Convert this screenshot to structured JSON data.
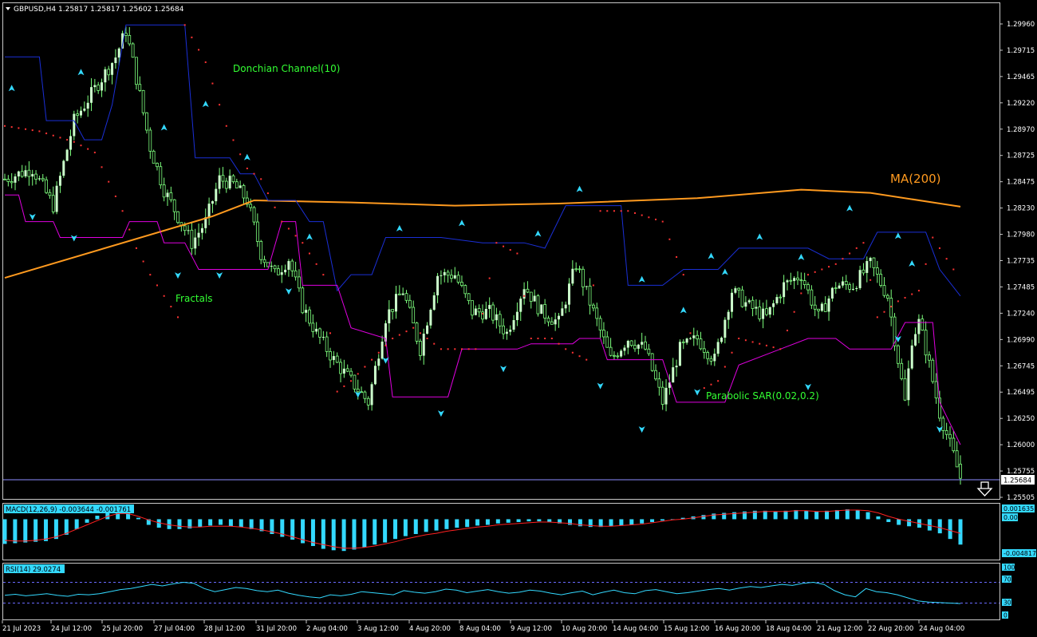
{
  "symbol_header": "GBPUSD,H4  1.25817 1.25817 1.25602 1.25684",
  "colors": {
    "background": "#000000",
    "bull_candle": "#ccffcc",
    "wick": "#7dff7d",
    "donchian": "#1a2fd6",
    "fractal_lower": "#e000e0",
    "ma200": "#ff9a1f",
    "sar": "#ff3333",
    "macd_hist": "#33d9ff",
    "macd_signal": "#ff2020",
    "rsi_line": "#33d9ff",
    "axis_text": "#ffffff",
    "label_green": "#33ff33"
  },
  "annotations": {
    "donchian": "Donchian Channel(10)",
    "fractals": "Fractals",
    "ma": "MA(200)",
    "sar": "Parabolic SAR(0.02,0.2)"
  },
  "price_axis": [
    "1.29960",
    "1.29715",
    "1.29465",
    "1.29220",
    "1.28970",
    "1.28725",
    "1.28475",
    "1.28230",
    "1.27980",
    "1.27735",
    "1.27485",
    "1.27240",
    "1.26990",
    "1.26745",
    "1.26495",
    "1.26250",
    "1.26000",
    "1.25755",
    "1.25505"
  ],
  "current_price": "1.25684",
  "macd": {
    "label": "MACD(12,26,9) -0.003644 -0.001761",
    "axis_top": "0.001635",
    "axis_zero": "0.00",
    "axis_bottom": "-0.004817"
  },
  "rsi": {
    "label": "RSI(14) 29.0274",
    "axis": [
      "100",
      "70",
      "30",
      "0"
    ]
  },
  "time_axis": [
    "21 Jul 2023",
    "24 Jul 12:00",
    "25 Jul 20:00",
    "27 Jul 04:00",
    "28 Jul 12:00",
    "31 Jul 20:00",
    "2 Aug 04:00",
    "3 Aug 12:00",
    "4 Aug 20:00",
    "8 Aug 04:00",
    "9 Aug 12:00",
    "10 Aug 20:00",
    "14 Aug 04:00",
    "15 Aug 12:00",
    "16 Aug 20:00",
    "18 Aug 04:00",
    "21 Aug 12:00",
    "22 Aug 20:00",
    "24 Aug 04:00"
  ],
  "chart_data": {
    "type": "candlestick",
    "symbol": "GBPUSD",
    "timeframe": "H4",
    "ohlc_last": {
      "open": 1.25817,
      "high": 1.25817,
      "low": 1.25602,
      "close": 1.25684
    },
    "ylim": [
      1.2548,
      1.3013
    ],
    "close_path": [
      [
        0,
        1.285
      ],
      [
        8,
        1.286
      ],
      [
        14,
        1.2825
      ],
      [
        20,
        1.2905
      ],
      [
        26,
        1.2935
      ],
      [
        32,
        1.2965
      ],
      [
        35,
        1.299
      ],
      [
        38,
        1.2945
      ],
      [
        42,
        1.288
      ],
      [
        46,
        1.284
      ],
      [
        50,
        1.2815
      ],
      [
        54,
        1.279
      ],
      [
        58,
        1.281
      ],
      [
        62,
        1.285
      ],
      [
        66,
        1.2845
      ],
      [
        70,
        1.283
      ],
      [
        74,
        1.278
      ],
      [
        78,
        1.276
      ],
      [
        82,
        1.2775
      ],
      [
        86,
        1.273
      ],
      [
        90,
        1.2705
      ],
      [
        95,
        1.268
      ],
      [
        100,
        1.266
      ],
      [
        105,
        1.264
      ],
      [
        110,
        1.272
      ],
      [
        115,
        1.2745
      ],
      [
        120,
        1.269
      ],
      [
        125,
        1.276
      ],
      [
        130,
        1.276
      ],
      [
        135,
        1.2725
      ],
      [
        140,
        1.2725
      ],
      [
        145,
        1.2705
      ],
      [
        150,
        1.275
      ],
      [
        155,
        1.2725
      ],
      [
        160,
        1.2715
      ],
      [
        165,
        1.277
      ],
      [
        170,
        1.2725
      ],
      [
        175,
        1.268
      ],
      [
        180,
        1.27
      ],
      [
        185,
        1.269
      ],
      [
        190,
        1.264
      ],
      [
        195,
        1.269
      ],
      [
        200,
        1.27
      ],
      [
        205,
        1.268
      ],
      [
        210,
        1.2745
      ],
      [
        215,
        1.273
      ],
      [
        220,
        1.272
      ],
      [
        225,
        1.275
      ],
      [
        230,
        1.276
      ],
      [
        235,
        1.272
      ],
      [
        240,
        1.275
      ],
      [
        245,
        1.275
      ],
      [
        250,
        1.277
      ],
      [
        255,
        1.274
      ],
      [
        258,
        1.268
      ],
      [
        260,
        1.264
      ],
      [
        262,
        1.27
      ],
      [
        264,
        1.2715
      ],
      [
        266,
        1.269
      ],
      [
        268,
        1.266
      ],
      [
        270,
        1.263
      ],
      [
        272,
        1.261
      ],
      [
        274,
        1.259
      ],
      [
        276,
        1.2568
      ]
    ],
    "ma200": [
      [
        0,
        1.2757
      ],
      [
        60,
        1.2815
      ],
      [
        72,
        1.283
      ],
      [
        100,
        1.2828
      ],
      [
        130,
        1.2825
      ],
      [
        160,
        1.2827
      ],
      [
        200,
        1.2832
      ],
      [
        230,
        1.284
      ],
      [
        250,
        1.2837
      ],
      [
        276,
        1.2824
      ]
    ],
    "donchian_upper": [
      [
        0,
        1.2965
      ],
      [
        10,
        1.2965
      ],
      [
        12,
        1.2905
      ],
      [
        20,
        1.2905
      ],
      [
        23,
        1.2887
      ],
      [
        28,
        1.2887
      ],
      [
        31,
        1.292
      ],
      [
        35,
        1.2995
      ],
      [
        52,
        1.2995
      ],
      [
        55,
        1.287
      ],
      [
        65,
        1.287
      ],
      [
        68,
        1.2855
      ],
      [
        72,
        1.2855
      ],
      [
        76,
        1.283
      ],
      [
        84,
        1.283
      ],
      [
        88,
        1.281
      ],
      [
        92,
        1.281
      ],
      [
        96,
        1.2745
      ],
      [
        100,
        1.276
      ],
      [
        106,
        1.276
      ],
      [
        110,
        1.2795
      ],
      [
        126,
        1.2795
      ],
      [
        138,
        1.279
      ],
      [
        150,
        1.279
      ],
      [
        156,
        1.2785
      ],
      [
        162,
        1.2825
      ],
      [
        178,
        1.2825
      ],
      [
        180,
        1.275
      ],
      [
        190,
        1.275
      ],
      [
        196,
        1.2765
      ],
      [
        206,
        1.2765
      ],
      [
        212,
        1.2785
      ],
      [
        232,
        1.2785
      ],
      [
        238,
        1.2775
      ],
      [
        248,
        1.2775
      ],
      [
        252,
        1.28
      ],
      [
        266,
        1.28
      ],
      [
        270,
        1.2765
      ],
      [
        276,
        1.274
      ]
    ],
    "donchian_lower": [
      [
        0,
        1.2835
      ],
      [
        4,
        1.2835
      ],
      [
        6,
        1.281
      ],
      [
        14,
        1.281
      ],
      [
        16,
        1.2795
      ],
      [
        34,
        1.2795
      ],
      [
        36,
        1.281
      ],
      [
        44,
        1.281
      ],
      [
        46,
        1.279
      ],
      [
        52,
        1.279
      ],
      [
        56,
        1.2765
      ],
      [
        76,
        1.2765
      ],
      [
        80,
        1.281
      ],
      [
        84,
        1.281
      ],
      [
        86,
        1.275
      ],
      [
        96,
        1.275
      ],
      [
        100,
        1.271
      ],
      [
        110,
        1.27
      ],
      [
        112,
        1.2645
      ],
      [
        128,
        1.2645
      ],
      [
        132,
        1.269
      ],
      [
        148,
        1.269
      ],
      [
        152,
        1.2695
      ],
      [
        164,
        1.2695
      ],
      [
        166,
        1.27
      ],
      [
        172,
        1.27
      ],
      [
        174,
        1.268
      ],
      [
        190,
        1.268
      ],
      [
        194,
        1.264
      ],
      [
        208,
        1.264
      ],
      [
        212,
        1.2675
      ],
      [
        224,
        1.269
      ],
      [
        232,
        1.27
      ],
      [
        240,
        1.27
      ],
      [
        244,
        1.269
      ],
      [
        256,
        1.269
      ],
      [
        260,
        1.2715
      ],
      [
        268,
        1.2715
      ],
      [
        270,
        1.264
      ],
      [
        276,
        1.26
      ]
    ],
    "sar": [
      [
        0,
        1.29
      ],
      [
        10,
        1.2895
      ],
      [
        20,
        1.2885
      ],
      [
        26,
        1.2875
      ],
      [
        34,
        1.282
      ],
      [
        38,
        1.2785
      ],
      [
        42,
        1.276
      ],
      [
        46,
        1.274
      ],
      [
        50,
        1.272
      ],
      [
        52,
        1.2995
      ],
      [
        58,
        1.296
      ],
      [
        64,
        1.29
      ],
      [
        70,
        1.286
      ],
      [
        74,
        1.285
      ],
      [
        80,
        1.281
      ],
      [
        86,
        1.279
      ],
      [
        92,
        1.276
      ],
      [
        96,
        1.265
      ],
      [
        100,
        1.266
      ],
      [
        106,
        1.268
      ],
      [
        112,
        1.27
      ],
      [
        118,
        1.271
      ],
      [
        126,
        1.269
      ],
      [
        136,
        1.269
      ],
      [
        142,
        1.279
      ],
      [
        148,
        1.278
      ],
      [
        152,
        1.27
      ],
      [
        158,
        1.27
      ],
      [
        162,
        1.269
      ],
      [
        168,
        1.268
      ],
      [
        172,
        1.282
      ],
      [
        180,
        1.282
      ],
      [
        190,
        1.281
      ],
      [
        196,
        1.276
      ],
      [
        200,
        1.265
      ],
      [
        206,
        1.266
      ],
      [
        212,
        1.27
      ],
      [
        224,
        1.269
      ],
      [
        232,
        1.276
      ],
      [
        240,
        1.277
      ],
      [
        248,
        1.279
      ],
      [
        252,
        1.272
      ],
      [
        258,
        1.2735
      ],
      [
        264,
        1.2745
      ],
      [
        268,
        1.2795
      ],
      [
        272,
        1.2775
      ],
      [
        276,
        1.2755
      ]
    ],
    "fractals_up": [
      [
        2,
        1.2935
      ],
      [
        22,
        1.295
      ],
      [
        46,
        1.2898
      ],
      [
        58,
        1.292
      ],
      [
        70,
        1.287
      ],
      [
        88,
        1.2795
      ],
      [
        114,
        1.2803
      ],
      [
        132,
        1.2808
      ],
      [
        154,
        1.2798
      ],
      [
        166,
        1.284
      ],
      [
        184,
        1.2755
      ],
      [
        196,
        1.2726
      ],
      [
        204,
        1.2777
      ],
      [
        208,
        1.2762
      ],
      [
        218,
        1.2795
      ],
      [
        230,
        1.2776
      ],
      [
        244,
        1.2822
      ],
      [
        258,
        1.2796
      ],
      [
        262,
        1.277
      ]
    ],
    "fractals_down": [
      [
        8,
        1.2815
      ],
      [
        20,
        1.2795
      ],
      [
        50,
        1.276
      ],
      [
        62,
        1.276
      ],
      [
        82,
        1.2745
      ],
      [
        102,
        1.2648
      ],
      [
        110,
        1.268
      ],
      [
        126,
        1.263
      ],
      [
        144,
        1.2672
      ],
      [
        172,
        1.2656
      ],
      [
        184,
        1.2615
      ],
      [
        200,
        1.265
      ],
      [
        232,
        1.2655
      ],
      [
        258,
        1.27
      ],
      [
        270,
        1.2615
      ]
    ],
    "macd_hist": [
      -0.0035,
      -0.0034,
      -0.0033,
      -0.0032,
      -0.0031,
      -0.0028,
      -0.0022,
      -0.0014,
      -0.0005,
      0.0005,
      0.001,
      0.0016,
      0.0012,
      0.0002,
      -0.0008,
      -0.0012,
      -0.0014,
      -0.0014,
      -0.0013,
      -0.0011,
      -0.0009,
      -0.0008,
      -0.001,
      -0.0011,
      -0.0014,
      -0.0017,
      -0.0021,
      -0.0025,
      -0.0029,
      -0.0034,
      -0.0038,
      -0.0042,
      -0.0044,
      -0.0045,
      -0.0043,
      -0.004,
      -0.0036,
      -0.0033,
      -0.0028,
      -0.0024,
      -0.0021,
      -0.0018,
      -0.0016,
      -0.0014,
      -0.0012,
      -0.0011,
      -0.0009,
      -0.0008,
      -0.0006,
      -0.0005,
      -0.0004,
      -0.0003,
      -0.0003,
      -0.0004,
      -0.0006,
      -0.0008,
      -0.001,
      -0.0011,
      -0.0011,
      -0.001,
      -0.0009,
      -0.0008,
      -0.0006,
      -0.0004,
      -0.0002,
      0.0,
      0.0002,
      0.0004,
      0.0006,
      0.0008,
      0.0009,
      0.001,
      0.0011,
      0.0012,
      0.0012,
      0.0011,
      0.0012,
      0.0013,
      0.0012,
      0.0011,
      0.0012,
      0.0013,
      0.0014,
      0.0013,
      0.001,
      0.0004,
      -0.0004,
      -0.0008,
      -0.001,
      -0.0012,
      -0.0016,
      -0.002,
      -0.0028,
      -0.0036
    ],
    "macd_signal": [
      -0.003,
      -0.0031,
      -0.0031,
      -0.003,
      -0.0028,
      -0.0025,
      -0.002,
      -0.0014,
      -0.0008,
      -0.0002,
      0.0004,
      0.0008,
      0.0008,
      0.0004,
      -0.0001,
      -0.0005,
      -0.0008,
      -0.001,
      -0.0011,
      -0.0011,
      -0.001,
      -0.001,
      -0.001,
      -0.0011,
      -0.0013,
      -0.0015,
      -0.0018,
      -0.0021,
      -0.0025,
      -0.0029,
      -0.0033,
      -0.0036,
      -0.0039,
      -0.0041,
      -0.0041,
      -0.004,
      -0.0038,
      -0.0035,
      -0.0032,
      -0.0028,
      -0.0025,
      -0.0022,
      -0.002,
      -0.0017,
      -0.0015,
      -0.0013,
      -0.0011,
      -0.001,
      -0.0008,
      -0.0007,
      -0.0006,
      -0.0005,
      -0.0004,
      -0.0004,
      -0.0005,
      -0.0006,
      -0.0008,
      -0.0009,
      -0.001,
      -0.001,
      -0.0009,
      -0.0008,
      -0.0007,
      -0.0005,
      -0.0003,
      -0.0001,
      0.0,
      0.0002,
      0.0004,
      0.0006,
      0.0007,
      0.0008,
      0.0009,
      0.001,
      0.0011,
      0.0011,
      0.0011,
      0.0012,
      0.0012,
      0.0011,
      0.0011,
      0.0012,
      0.0013,
      0.0013,
      0.0012,
      0.0009,
      0.0004,
      0.0,
      -0.0003,
      -0.0006,
      -0.0009,
      -0.0012,
      -0.0016,
      -0.002
    ],
    "rsi": [
      45,
      47,
      44,
      46,
      48,
      45,
      43,
      47,
      46,
      48,
      52,
      56,
      58,
      62,
      66,
      63,
      67,
      70,
      68,
      58,
      52,
      56,
      60,
      58,
      54,
      52,
      55,
      49,
      45,
      42,
      40,
      46,
      44,
      47,
      52,
      50,
      48,
      46,
      54,
      51,
      49,
      52,
      57,
      55,
      50,
      53,
      56,
      52,
      49,
      51,
      55,
      53,
      49,
      46,
      50,
      53,
      46,
      51,
      55,
      50,
      48,
      54,
      56,
      52,
      48,
      50,
      53,
      56,
      58,
      55,
      59,
      62,
      60,
      63,
      66,
      64,
      68,
      70,
      66,
      54,
      46,
      42,
      58,
      52,
      50,
      46,
      40,
      34,
      32,
      31,
      30,
      29
    ],
    "rsi_levels": [
      70,
      30
    ]
  }
}
